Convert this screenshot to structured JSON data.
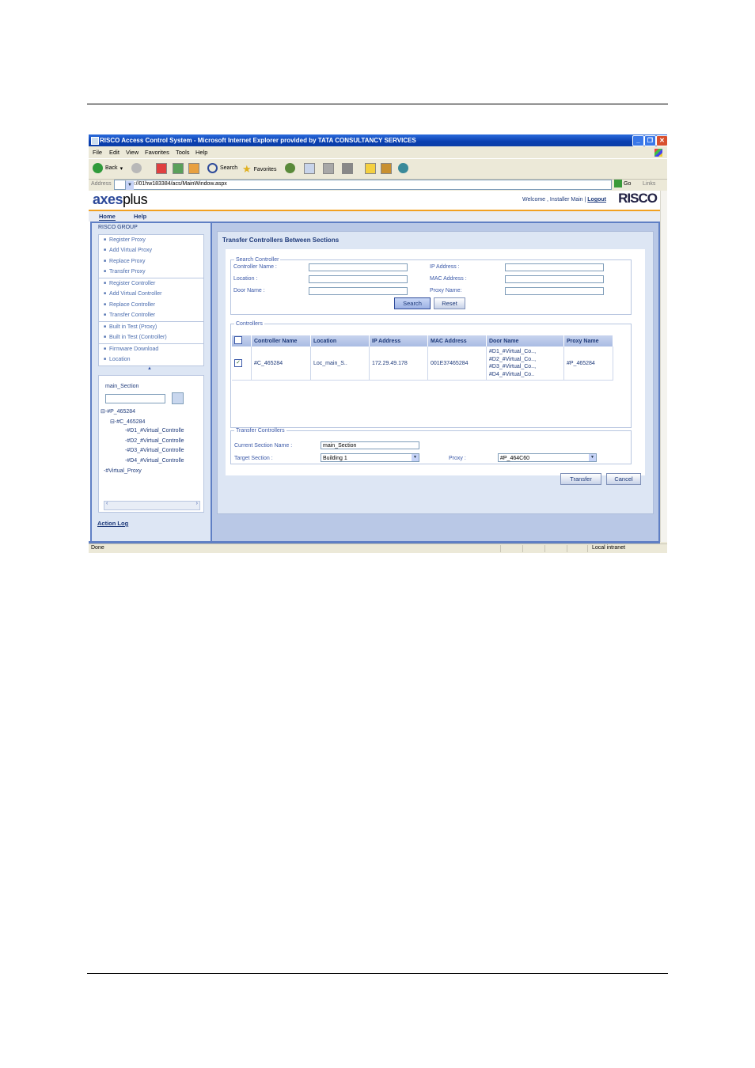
{
  "window": {
    "title": "RISCO Access Control System - Microsoft Internet Explorer provided by TATA CONSULTANCY SERVICES",
    "controls": [
      "_",
      "❐",
      "✕"
    ]
  },
  "menubar": [
    "File",
    "Edit",
    "View",
    "Favorites",
    "Tools",
    "Help"
  ],
  "toolbar": {
    "back": "Back",
    "search": "Search",
    "favorites": "Favorites"
  },
  "address": {
    "label": "Address",
    "url": "http://01hw183384/acs/MainWindow.aspx",
    "go": "Go",
    "links": "Links"
  },
  "header": {
    "logo_bold": "axes",
    "logo_light": "plus",
    "welcome": "Welcome ,  Installer Main",
    "separator": "|",
    "logout": "Logout",
    "brand": "RISCO"
  },
  "nav": {
    "home": "Home",
    "help": "Help"
  },
  "sidebar": {
    "group": "RISCO GROUP",
    "proxy_items": [
      "Register Proxy",
      "Add Virtual Proxy",
      "Replace Proxy",
      "Transfer Proxy"
    ],
    "controller_items": [
      "Register Controller",
      "Add Virtual Controller",
      "Replace Controller",
      "Transfer Controller"
    ],
    "test_items": [
      "Built in Test (Proxy)",
      "Built in Test (Controller)"
    ],
    "other_items": [
      "Firmware Download",
      "Location"
    ],
    "collapse": "▲",
    "section": "main_Section",
    "tree": [
      "⊟-#P_465284",
      "⊟-#C_465284",
      "-#D1_#Virtual_Controlle",
      "-#D2_#Virtual_Controlle",
      "-#D3_#Virtual_Controlle",
      "-#D4_#Virtual_Controlle",
      "-#Virtual_Proxy"
    ],
    "scroll_left": "‹",
    "scroll_right": "›",
    "action_log": "Action Log"
  },
  "main": {
    "title": "Transfer Controllers Between Sections",
    "search": {
      "legend": "Search Controller",
      "controller_name": "Controller Name :",
      "location": "Location :",
      "door_name": "Door Name :",
      "ip_address": "IP Address :",
      "mac_address": "MAC Address :",
      "proxy_name": "Proxy Name:",
      "search_btn": "Search",
      "reset_btn": "Reset"
    },
    "controllers": {
      "legend": "Controllers",
      "columns": [
        "Controller Name",
        "Location",
        "IP Address",
        "MAC Address",
        "Door Name",
        "Proxy Name"
      ],
      "rows": [
        {
          "checked": "✓",
          "controller": "#C_465284",
          "location": "Loc_main_S..",
          "ip": "172.29.49.178",
          "mac": "001E37465284",
          "doors": [
            "#D1_#Virtual_Co..,",
            "#D2_#Virtual_Co..,",
            "#D3_#Virtual_Co..,",
            "#D4_#Virtual_Co.."
          ],
          "proxy": "#P_465284"
        }
      ]
    },
    "transfer": {
      "legend": "Transfer Controllers",
      "current_label": "Current Section Name :",
      "current_value": "main_Section",
      "target_label": "Target Section :",
      "target_value": "Building 1",
      "proxy_label": "Proxy :",
      "proxy_value": "#P_464C60"
    },
    "transfer_btn": "Transfer",
    "cancel_btn": "Cancel"
  },
  "status": {
    "left": "Done",
    "right": "Local intranet"
  }
}
